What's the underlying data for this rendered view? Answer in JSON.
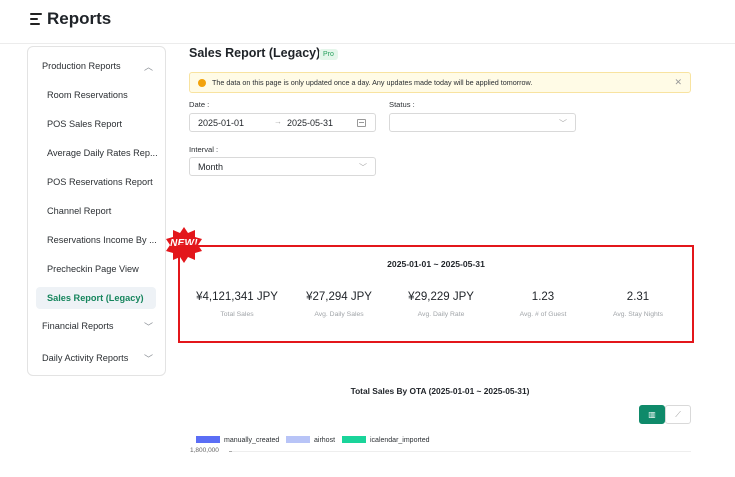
{
  "header": {
    "title": "Reports"
  },
  "sidebar": {
    "sections": [
      {
        "label": "Production Reports",
        "expanded": true
      },
      {
        "label": "Financial Reports",
        "expanded": false
      },
      {
        "label": "Daily Activity Reports",
        "expanded": false
      }
    ],
    "items": [
      "Room Reservations",
      "POS Sales Report",
      "Average Daily Rates Rep...",
      "POS Reservations Report",
      "Channel Report",
      "Reservations Income By ...",
      "Precheckin Page View",
      "Sales Report (Legacy)"
    ],
    "active_item": "Sales Report (Legacy)"
  },
  "page": {
    "title": "Sales Report (Legacy)",
    "badge": "Pro"
  },
  "notice": {
    "text": "The data on this page is only updated once a day. Any updates made today will be applied tomorrow."
  },
  "filters": {
    "date_label": "Date :",
    "date_start": "2025-01-01",
    "date_end": "2025-05-31",
    "status_label": "Status :",
    "status_value": "",
    "interval_label": "Interval :",
    "interval_value": "Month"
  },
  "badge_new": "NEW!",
  "summary": {
    "range": "2025-01-01 ~ 2025-05-31",
    "stats": [
      {
        "value": "¥4,121,341 JPY",
        "caption": "Total Sales"
      },
      {
        "value": "¥27,294 JPY",
        "caption": "Avg. Daily Sales"
      },
      {
        "value": "¥29,229 JPY",
        "caption": "Avg. Daily Rate"
      },
      {
        "value": "1.23",
        "caption": "Avg. # of Guest"
      },
      {
        "value": "2.31",
        "caption": "Avg. Stay Nights"
      }
    ]
  },
  "chart": {
    "title": "Total Sales By OTA (2025-01-01 ~ 2025-05-31)",
    "legend": [
      {
        "name": "manually_created",
        "color": "#5b6ef5"
      },
      {
        "name": "airhost",
        "color": "#b8c4f7"
      },
      {
        "name": "icalendar_imported",
        "color": "#1ad49a"
      }
    ],
    "y_top_tick": "1,800,000",
    "active_view": "bar"
  },
  "colors": {
    "accent": "#16855d",
    "highlight_border": "#e3161b",
    "new_badge": "#e3161b"
  }
}
